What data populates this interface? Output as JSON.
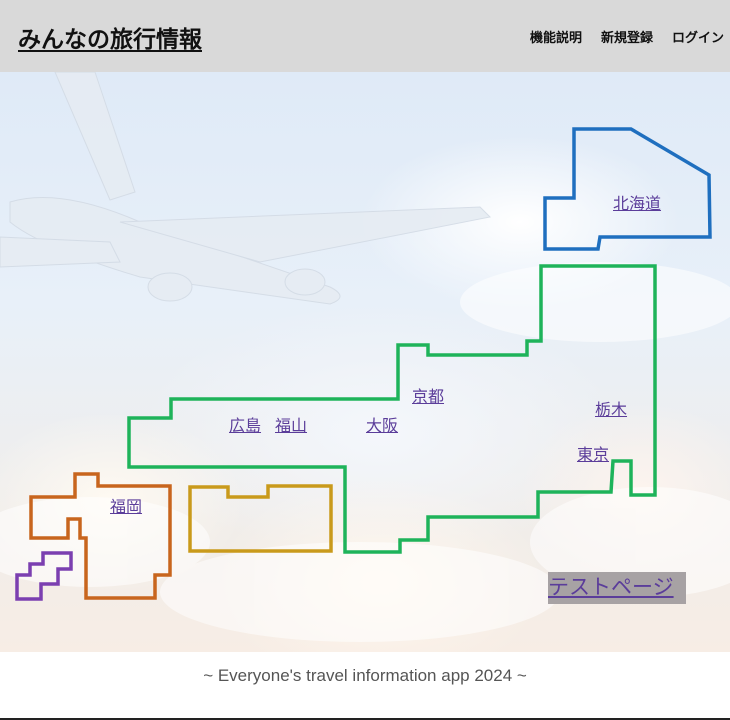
{
  "header": {
    "title": "みんなの旅行情報",
    "nav": {
      "features": "機能説明",
      "register": "新規登録",
      "login": "ログイン"
    }
  },
  "map": {
    "regions": [
      {
        "id": "hokkaido",
        "color": "#1f6fbf"
      },
      {
        "id": "honshu",
        "color": "#1eb35a"
      },
      {
        "id": "shikoku",
        "color": "#c99a1b"
      },
      {
        "id": "kyushu",
        "color": "#c8651d"
      },
      {
        "id": "okinawa",
        "color": "#7b3fb0"
      }
    ],
    "links": {
      "hokkaido": "北海道",
      "kyoto": "京都",
      "tochigi": "栃木",
      "hiroshima": "広島",
      "fukuyama": "福山",
      "osaka": "大阪",
      "tokyo": "東京",
      "fukuoka": "福岡"
    },
    "test_page": "テストページ"
  },
  "footer": {
    "text": "~ Everyone's travel information app 2024 ~"
  }
}
